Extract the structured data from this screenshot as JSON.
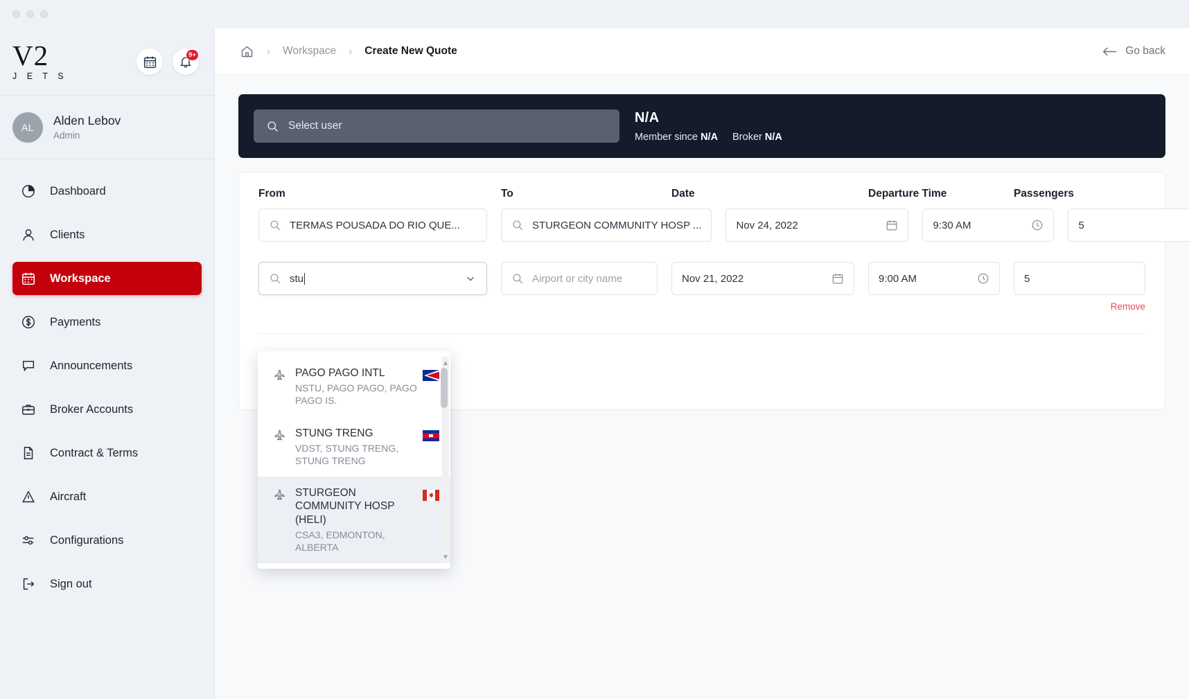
{
  "app": {
    "logo_primary": "V2",
    "logo_secondary": "J E T S",
    "notification_badge": "9+"
  },
  "sidebar": {
    "user": {
      "initials": "AL",
      "name": "Alden Lebov",
      "role": "Admin"
    },
    "items": [
      {
        "label": "Dashboard",
        "icon": "pie-chart-icon",
        "active": false
      },
      {
        "label": "Clients",
        "icon": "user-icon",
        "active": false
      },
      {
        "label": "Workspace",
        "icon": "calendar-icon",
        "active": true
      },
      {
        "label": "Payments",
        "icon": "dollar-circle-icon",
        "active": false
      },
      {
        "label": "Announcements",
        "icon": "speech-bubble-icon",
        "active": false
      },
      {
        "label": "Broker Accounts",
        "icon": "briefcase-icon",
        "active": false
      },
      {
        "label": "Contract & Terms",
        "icon": "document-icon",
        "active": false
      },
      {
        "label": "Aircraft",
        "icon": "triangle-alert-icon",
        "active": false
      },
      {
        "label": "Configurations",
        "icon": "sliders-icon",
        "active": false
      },
      {
        "label": "Sign out",
        "icon": "logout-icon",
        "active": false
      }
    ]
  },
  "topbar": {
    "home_icon": "home-icon",
    "crumb_workspace": "Workspace",
    "crumb_current": "Create New Quote",
    "separator": "›",
    "go_back": "Go back"
  },
  "banner": {
    "user_search_placeholder": "Select user",
    "name": "N/A",
    "member_since_label": "Member since",
    "member_since_value": "N/A",
    "broker_label": "Broker",
    "broker_value": "N/A"
  },
  "form": {
    "headers": {
      "from": "From",
      "to": "To",
      "date": "Date",
      "departure_time": "Departure Time",
      "passengers": "Passengers"
    },
    "rows": [
      {
        "from_value": "TERMAS POUSADA DO RIO QUE...",
        "to_value": "STURGEON COMMUNITY HOSP ...",
        "date": "Nov 24, 2022",
        "time": "9:30 AM",
        "passengers": "5"
      },
      {
        "from_value": "stu",
        "to_placeholder": "Airport or city name",
        "date": "Nov 21, 2022",
        "time": "9:00 AM",
        "passengers": "5",
        "remove_label": "Remove"
      }
    ]
  },
  "dropdown": {
    "options": [
      {
        "title": "PAGO PAGO INTL",
        "subtitle": "NSTU, PAGO PAGO, PAGO PAGO IS.",
        "flag": "american-samoa-flag-icon",
        "highlighted": false
      },
      {
        "title": "STUNG TRENG",
        "subtitle": "VDST, STUNG TRENG, STUNG TRENG",
        "flag": "cambodia-flag-icon",
        "highlighted": false
      },
      {
        "title": "STURGEON COMMUNITY HOSP (HELI)",
        "subtitle": "CSA3, EDMONTON, ALBERTA",
        "flag": "canada-flag-icon",
        "highlighted": true
      }
    ]
  },
  "colors": {
    "accent_red": "#c4000c",
    "banner_dark": "#141b2b",
    "remove_red": "#e8485f",
    "sidebar_bg": "#eef1f5"
  }
}
